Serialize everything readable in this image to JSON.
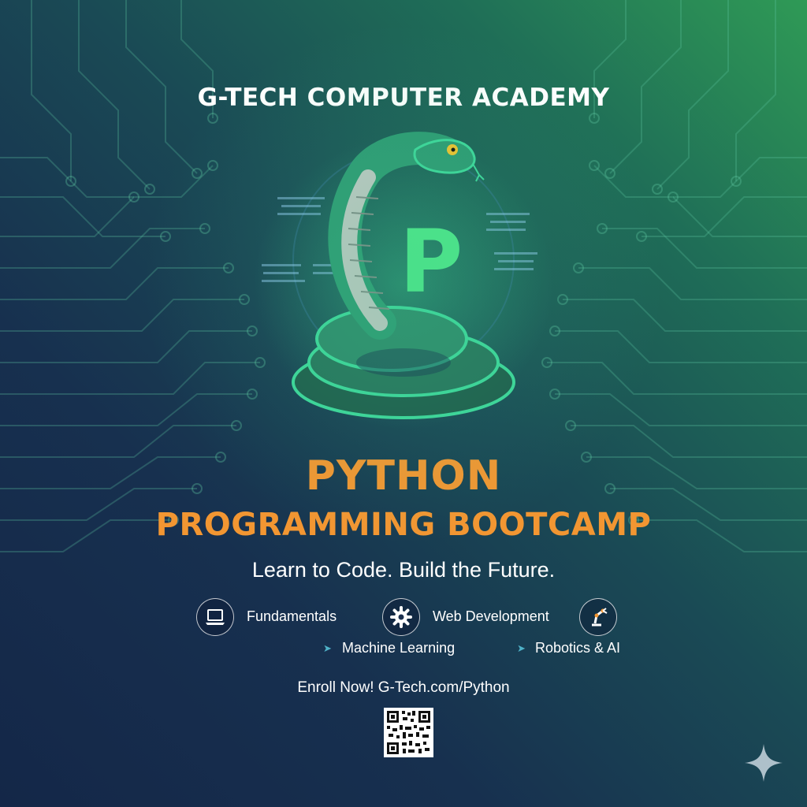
{
  "header": {
    "academy_name": "G-TECH COMPUTER ACADEMY"
  },
  "hero": {
    "logo_letter": "P"
  },
  "title": {
    "line1": "PYTHON",
    "line2": "PROGRAMMING BOOTCAMP"
  },
  "tagline": "Learn to Code. Build the Future.",
  "features": {
    "fundamentals": {
      "label": "Fundamentals",
      "icon": "laptop-icon"
    },
    "web_development": {
      "label": "Web Development",
      "icon": "gear-icon"
    },
    "robotics_ai": {
      "label": "Robotics & AI",
      "icon": "robot-arm-icon"
    },
    "machine_learning": {
      "label": "Machine Learning",
      "icon": "arrow-bullet-icon"
    }
  },
  "enroll": {
    "text": "Enroll Now! G-Tech.com/Python"
  },
  "colors": {
    "accent_orange": "#f29632",
    "snake_green": "#2e9a73",
    "logo_green": "#4ee68a",
    "bullet_blue": "#4fb2c8"
  }
}
